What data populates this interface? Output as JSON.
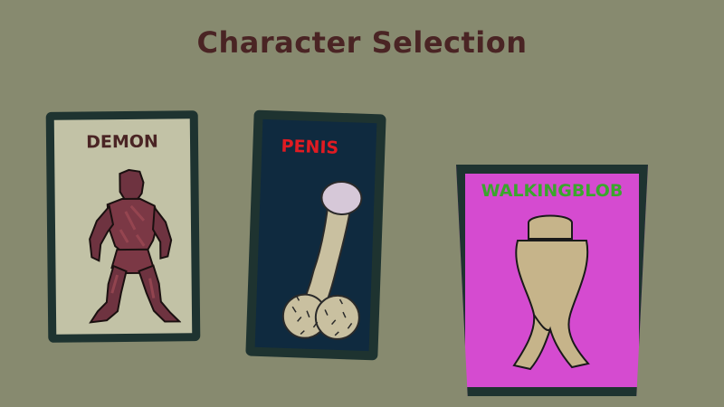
{
  "screen": {
    "title": "Character Selection"
  },
  "characters": [
    {
      "id": "demon",
      "name": "DEMON",
      "name_color": "#4a2424",
      "card_color": "#c2c2a6"
    },
    {
      "id": "penis",
      "name": "PENIS",
      "name_color": "#e01b22",
      "card_color": "#0f2a3f"
    },
    {
      "id": "walkingblob",
      "name": "WALKINGBLOB",
      "name_color": "#3aa62c",
      "card_color": "#d54bd0"
    }
  ],
  "colors": {
    "background": "#878a6f",
    "card_border": "#1e3330"
  }
}
